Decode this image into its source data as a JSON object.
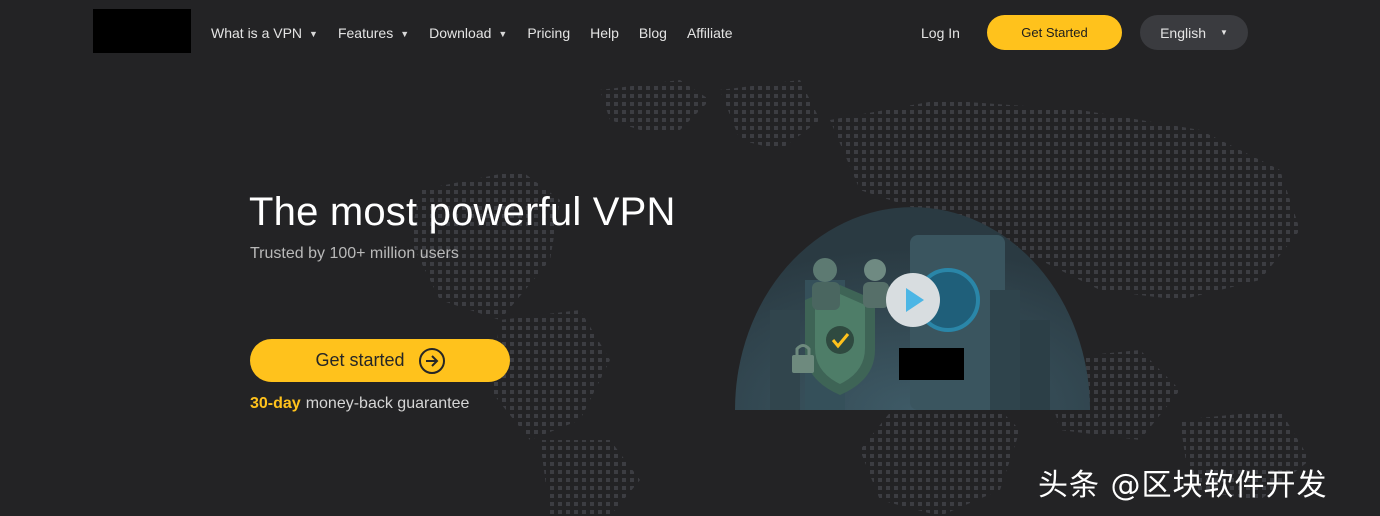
{
  "nav": {
    "items": [
      {
        "label": "What is a VPN",
        "has_dropdown": true
      },
      {
        "label": "Features",
        "has_dropdown": true
      },
      {
        "label": "Download",
        "has_dropdown": true
      },
      {
        "label": "Pricing",
        "has_dropdown": false
      },
      {
        "label": "Help",
        "has_dropdown": false
      },
      {
        "label": "Blog",
        "has_dropdown": false
      },
      {
        "label": "Affiliate",
        "has_dropdown": false
      }
    ],
    "login": "Log In",
    "get_started": "Get Started",
    "language": "English"
  },
  "hero": {
    "title": "The most powerful VPN",
    "subtitle": "Trusted by 100+ million users",
    "cta": "Get started",
    "guarantee_days": "30-day",
    "guarantee_rest": "money-back guarantee"
  },
  "watermark": "头条 @区块软件开发",
  "colors": {
    "background": "#232325",
    "accent": "#ffc21c",
    "lang_button": "#3a3b3f"
  }
}
